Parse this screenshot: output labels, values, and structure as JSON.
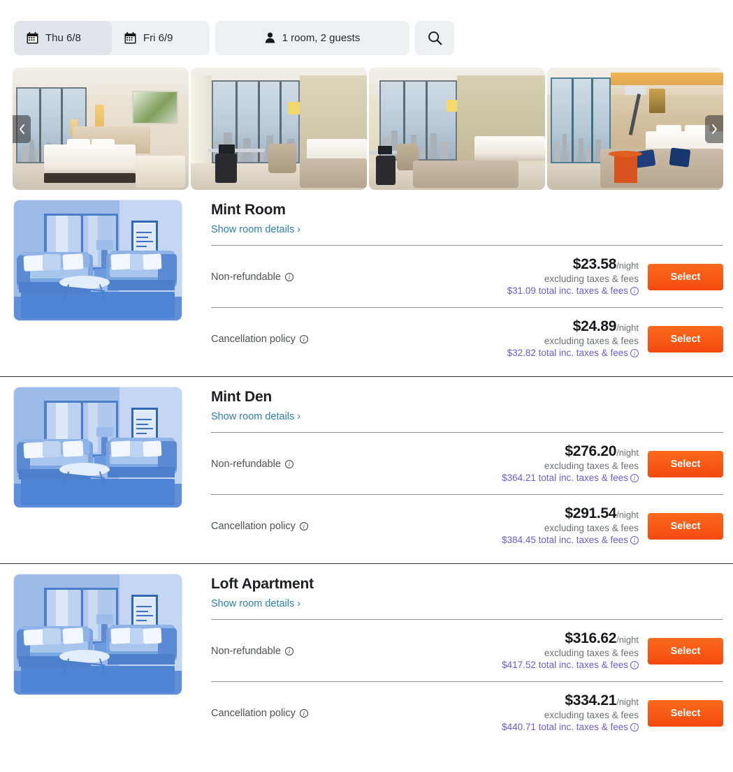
{
  "search": {
    "check_in": "Thu 6/8",
    "check_out": "Fri 6/9",
    "occupancy": "1 room, 2 guests",
    "calendar_icon": "calendar-icon",
    "person_icon": "person-icon",
    "search_icon": "search-icon"
  },
  "carousel": {
    "prev_label": "‹",
    "next_label": "›",
    "slide_count": 4,
    "slides": [
      {
        "alt": "hotel-room-bed-city-view"
      },
      {
        "alt": "hotel-room-desk-lounge-city-view"
      },
      {
        "alt": "hotel-room-sofa-desk-city-view"
      },
      {
        "alt": "hotel-room-bed-lamp-city-view"
      }
    ]
  },
  "labels": {
    "show_room_details": "Show room details",
    "chevron": "›",
    "select": "Select",
    "per_night": "/night",
    "excluding": "excluding taxes & fees",
    "total_suffix": "total inc. taxes & fees",
    "non_refundable": "Non-refundable",
    "cancellation_policy": "Cancellation policy"
  },
  "colors": {
    "select_button": "#f4490f",
    "link_teal": "#2b82ad",
    "link_purple": "#6a5bd6",
    "search_field_bg": "#eef1f4",
    "search_field_active_bg": "#dfe5ea"
  },
  "rooms": [
    {
      "name": "Mint Room",
      "thumbnail": "living-room-illustration",
      "rates": [
        {
          "policy": "Non-refundable",
          "price": "$23.58",
          "unit": "/night",
          "excluding": "excluding taxes & fees",
          "total": "$31.09 total inc. taxes & fees",
          "button": "Select"
        },
        {
          "policy": "Cancellation policy",
          "price": "$24.89",
          "unit": "/night",
          "excluding": "excluding taxes & fees",
          "total": "$32.82 total inc. taxes & fees",
          "button": "Select"
        }
      ]
    },
    {
      "name": "Mint Den",
      "thumbnail": "living-room-illustration",
      "rates": [
        {
          "policy": "Non-refundable",
          "price": "$276.20",
          "unit": "/night",
          "excluding": "excluding taxes & fees",
          "total": "$364.21 total inc. taxes & fees",
          "button": "Select"
        },
        {
          "policy": "Cancellation policy",
          "price": "$291.54",
          "unit": "/night",
          "excluding": "excluding taxes & fees",
          "total": "$384.45 total inc. taxes & fees",
          "button": "Select"
        }
      ]
    },
    {
      "name": "Loft Apartment",
      "thumbnail": "living-room-illustration",
      "rates": [
        {
          "policy": "Non-refundable",
          "price": "$316.62",
          "unit": "/night",
          "excluding": "excluding taxes & fees",
          "total": "$417.52 total inc. taxes & fees",
          "button": "Select"
        },
        {
          "policy": "Cancellation policy",
          "price": "$334.21",
          "unit": "/night",
          "excluding": "excluding taxes & fees",
          "total": "$440.71 total inc. taxes & fees",
          "button": "Select"
        }
      ]
    }
  ]
}
